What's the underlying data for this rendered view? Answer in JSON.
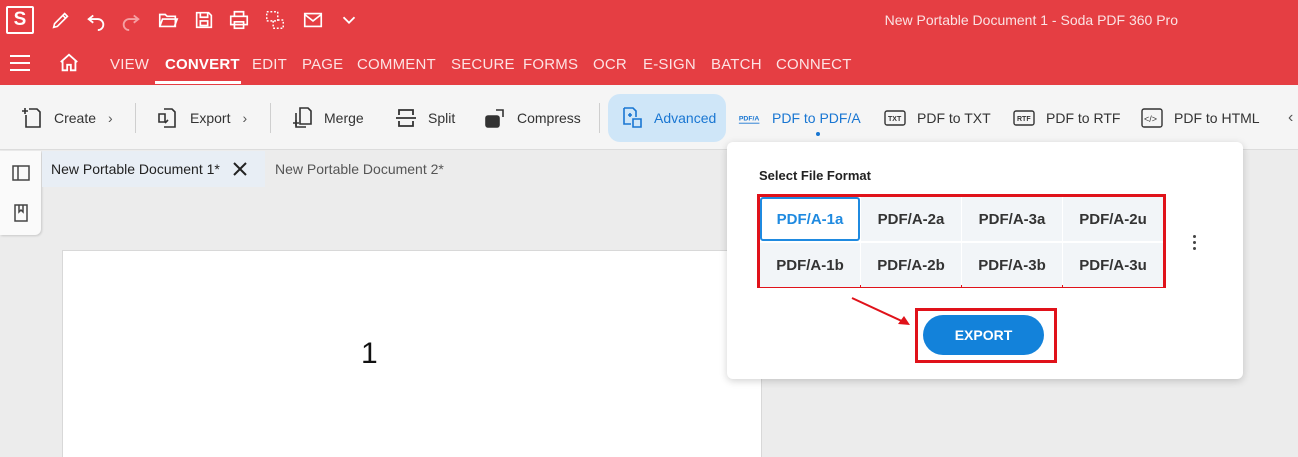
{
  "app": {
    "logo": "S",
    "window_title": "New Portable Document 1   -   Soda PDF 360 Pro",
    "brand_color": "#e53e43",
    "accent_color": "#1382da"
  },
  "quick_access": [
    "pen-icon",
    "undo-icon",
    "redo-icon",
    "open-folder-icon",
    "save-icon",
    "print-icon",
    "print-preview-icon",
    "email-icon",
    "chevron-down-icon"
  ],
  "menu": {
    "items": [
      "VIEW",
      "CONVERT",
      "EDIT",
      "PAGE",
      "COMMENT",
      "SECURE",
      "FORMS",
      "OCR",
      "E-SIGN",
      "BATCH",
      "CONNECT"
    ],
    "active": "CONVERT"
  },
  "toolbar": {
    "create": "Create",
    "export": "Export",
    "merge": "Merge",
    "split": "Split",
    "compress": "Compress",
    "advanced": "Advanced",
    "pdf_to_pdfa": "PDF to PDF/A",
    "pdf_to_txt": "PDF to TXT",
    "pdf_to_rtf": "PDF to RTF",
    "pdf_to_html": "PDF to HTML",
    "icon_tags": {
      "pdfa": "PDF/A",
      "txt": "TXT",
      "rtf": "RTF",
      "html": "</>"
    }
  },
  "tabs": [
    {
      "label": "New Portable Document 1*",
      "active": true
    },
    {
      "label": "New Portable Document 2*",
      "active": false
    }
  ],
  "document": {
    "page_number": "1"
  },
  "popup": {
    "title": "Select File Format",
    "formats": [
      "PDF/A-1a",
      "PDF/A-2a",
      "PDF/A-3a",
      "PDF/A-2u",
      "PDF/A-1b",
      "PDF/A-2b",
      "PDF/A-3b",
      "PDF/A-3u"
    ],
    "selected": "PDF/A-1a",
    "export_label": "EXPORT"
  }
}
